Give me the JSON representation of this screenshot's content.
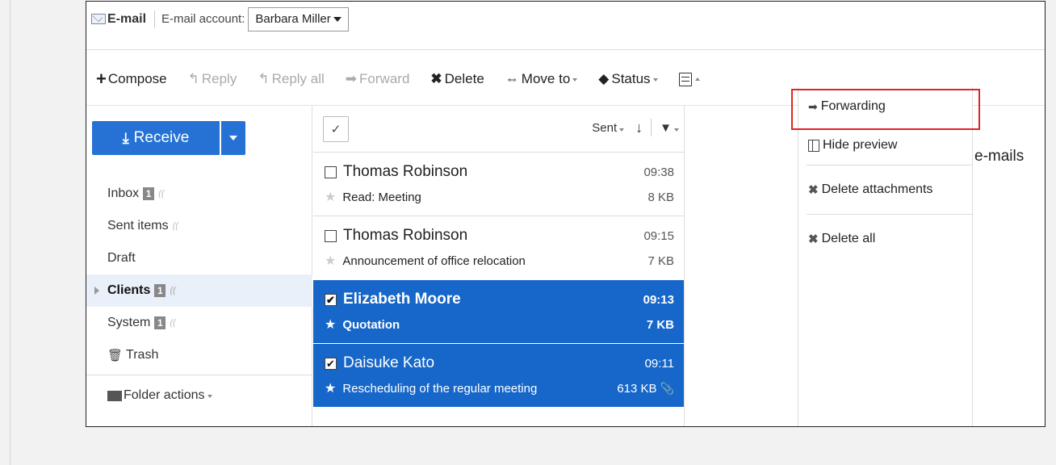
{
  "header": {
    "app_title": "E-mail",
    "account_label": "E-mail account:",
    "account_value": "Barbara Miller"
  },
  "toolbar": {
    "compose": "Compose",
    "reply": "Reply",
    "reply_all": "Reply all",
    "forward": "Forward",
    "delete": "Delete",
    "move_to": "Move to",
    "status": "Status"
  },
  "left": {
    "receive_label": "Receive",
    "folders": [
      {
        "label": "Inbox",
        "badge": "1"
      },
      {
        "label": "Sent items"
      },
      {
        "label": "Draft"
      },
      {
        "label": "Clients",
        "badge": "1"
      },
      {
        "label": "System",
        "badge": "1"
      },
      {
        "label": "Trash"
      }
    ],
    "folder_actions": "Folder actions"
  },
  "list": {
    "sort_label": "Sent",
    "items": [
      {
        "sender": "Thomas Robinson",
        "time": "09:38",
        "subject": "Read: Meeting",
        "size": "8 KB"
      },
      {
        "sender": "Thomas Robinson",
        "time": "09:15",
        "subject": "Announcement of office relocation",
        "size": "7 KB"
      },
      {
        "sender": "Elizabeth Moore",
        "time": "09:13",
        "subject": "Quotation",
        "size": "7 KB"
      },
      {
        "sender": "Daisuke Kato",
        "time": "09:11",
        "subject": "Rescheduling of the regular meeting",
        "size": "613 KB"
      }
    ]
  },
  "menu": {
    "forwarding": "Forwarding",
    "hide_preview": "Hide preview",
    "delete_attachments": "Delete attachments",
    "delete_all": "Delete all"
  },
  "preview": {
    "partial_text": "e-mails"
  },
  "colors": {
    "accent": "#2672d4",
    "selected_row": "#1667c9",
    "highlight_box": "#e32222"
  }
}
